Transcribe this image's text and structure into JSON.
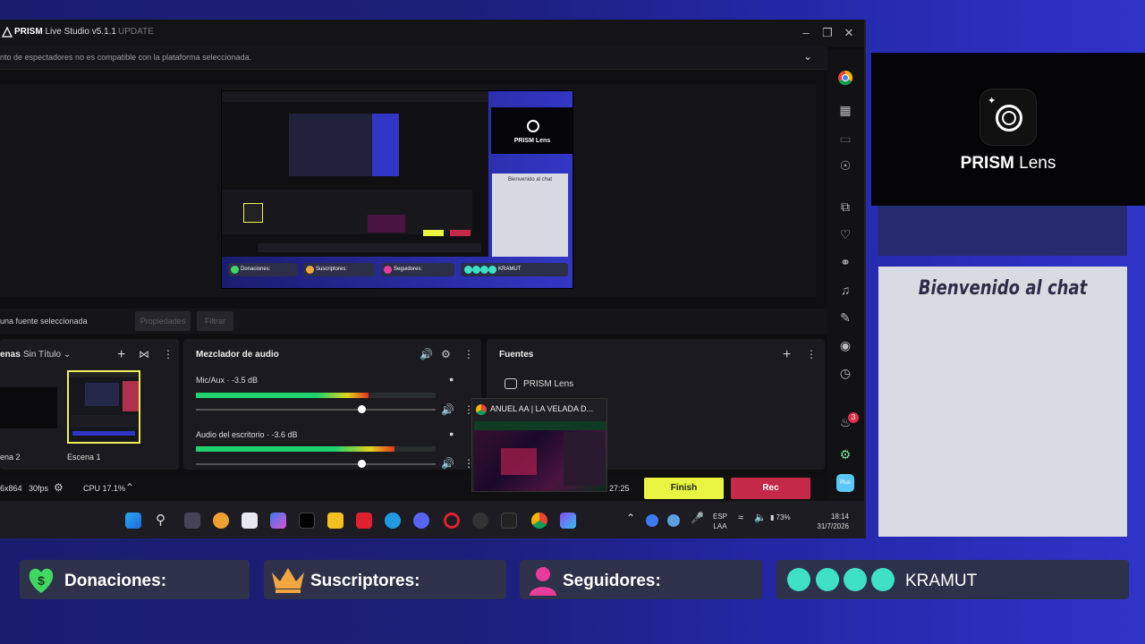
{
  "app": {
    "title_brand": "PRISM",
    "title_rest": "Live Studio v5.1.1",
    "update_label": "UPDATE",
    "notice": "nto de espectadores no es compatible con la plataforma seleccionada."
  },
  "preview": {
    "lens_label": "PRISM Lens",
    "chat_label": "Bienvenido al chat",
    "bars": [
      "Donaciones:",
      "Suscriptores:",
      "Seguidores:",
      "KRAMUT"
    ]
  },
  "props_bar": {
    "no_source": "una fuente seleccionada",
    "properties": "Propiedades",
    "filter": "Filtrar"
  },
  "scenes": {
    "title": "enas",
    "collection": "Sin Título",
    "items": [
      {
        "label": "ena 2"
      },
      {
        "label": "Escena 1"
      }
    ]
  },
  "mixer": {
    "title": "Mezclador de audio",
    "channels": [
      {
        "name": "Mic/Aux",
        "db": "-3.5 dB",
        "level": 0.72,
        "volume": 0.69
      },
      {
        "name": "Audio del escritorio",
        "db": "-3.6 dB",
        "level": 0.83,
        "volume": 0.69
      }
    ]
  },
  "sources": {
    "title": "Fuentes",
    "items": [
      {
        "label": "PRISM Lens"
      }
    ]
  },
  "popup": {
    "title": "ANUEL AA | LA VELADA D..."
  },
  "status": {
    "resolution": "6x864",
    "fps": "30fps",
    "cpu": "CPU 17.1%",
    "time": "27:25",
    "finish": "Finish",
    "rec": "Rec"
  },
  "rail": {
    "notification_count": "3",
    "plus_label": "Plus"
  },
  "taskbar": {
    "lang": "ESP",
    "layout": "LAA",
    "battery": "73%",
    "time": "18:14",
    "date": "31/7/2026"
  },
  "overlay": {
    "lens_brand": "PRISM",
    "lens_rest": " Lens",
    "chat_title": "Bienvenido al chat",
    "donations": "Donaciones:",
    "subscribers": "Suscriptores:",
    "followers": "Seguidores:",
    "streamer": "KRAMUT"
  },
  "colors": {
    "accent_yellow": "#e8f440",
    "rec_red": "#c5294a",
    "teal": "#3ee0c6",
    "pink": "#e83c9a",
    "green": "#40d860",
    "crown": "#f2a640"
  }
}
